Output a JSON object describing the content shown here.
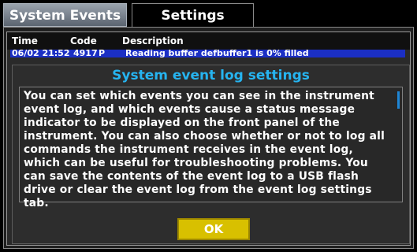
{
  "tabs": [
    {
      "label": "System Events",
      "active": true
    },
    {
      "label": "Settings",
      "active": false
    }
  ],
  "table": {
    "columns": [
      "Time",
      "Code",
      "Description"
    ],
    "selected_row": {
      "time": "06/02 21:52",
      "code": "4917",
      "flag": "P",
      "description": "Reading buffer defbuffer1 is 0% filled"
    }
  },
  "dialog": {
    "title": "System event log settings",
    "message": "You can set which events you can see in the instrument event log, and which events cause a status message indicator to be displayed on the front panel of the instrument. You can also choose whether or not to log all commands the instrument receives in the event log, which can be useful for troubleshooting problems. You can save the contents of the event log to a USB flash drive or clear the event log from the event log settings tab.",
    "ok_label": "OK"
  },
  "colors": {
    "title_accent": "#26b4f0",
    "ok_button": "#d8c000",
    "selection": "#1b2fc4",
    "scrollbar": "#1e86d6"
  }
}
